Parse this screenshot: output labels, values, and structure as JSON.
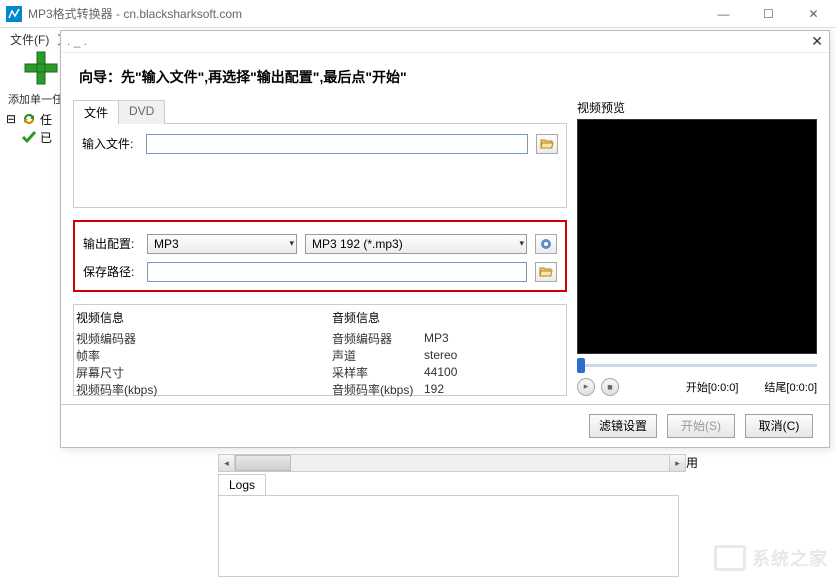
{
  "main_window": {
    "title": "MP3格式转换器 - cn.blacksharksoft.com",
    "menu": {
      "file": "文件(F)",
      "other": "〕"
    },
    "toolbar": {
      "add_label": "添加单一任…"
    },
    "tree": {
      "item1": "任",
      "item2": "已"
    },
    "extra_char": "用"
  },
  "dialog": {
    "titlebar": ". _ .",
    "header": "向导：先\"输入文件\",再选择\"输出配置\",最后点\"开始\"",
    "tabs": {
      "file": "文件",
      "dvd": "DVD"
    },
    "input_file_label": "输入文件:",
    "output_config_label": "输出配置:",
    "save_path_label": "保存路径:",
    "select_format": "MP3",
    "select_profile": "MP3 192 (*.mp3)",
    "video_info": {
      "title": "视频信息",
      "codec_label": "视频编码器",
      "fps_label": "帧率",
      "size_label": "屏幕尺寸",
      "bitrate_label": "视频码率(kbps)"
    },
    "audio_info": {
      "title": "音频信息",
      "codec_label": "音频编码器",
      "codec_val": "MP3",
      "channels_label": "声道",
      "channels_val": "stereo",
      "sample_label": "采样率",
      "sample_val": "44100",
      "bitrate_label": "音频码率(kbps)",
      "bitrate_val": "192"
    },
    "preview_label": "视频预览",
    "play": {
      "start_label": "开始",
      "start_time": "[0:0:0]",
      "end_label": "结尾",
      "end_time": "[0:0:0]"
    },
    "buttons": {
      "filter": "滤镜设置",
      "start": "开始(S)",
      "cancel": "取消(C)"
    }
  },
  "logs": {
    "tab": "Logs"
  },
  "watermark": "系统之家"
}
